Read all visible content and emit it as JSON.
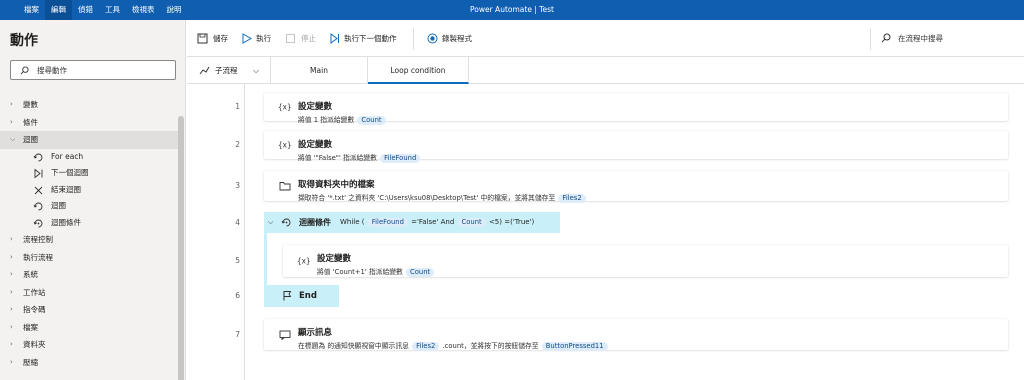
{
  "menu": {
    "items": [
      "檔案",
      "編輯",
      "偵錯",
      "工具",
      "檢視表",
      "說明"
    ],
    "active_index": 1
  },
  "app_title": "Power Automate | Test",
  "actions_pane": {
    "title": "動作",
    "search_placeholder": "搜尋動作",
    "categories_top": [
      {
        "label": "變數",
        "name": "variables"
      },
      {
        "label": "條件",
        "name": "conditions"
      },
      {
        "label": "迴圈",
        "name": "loops"
      }
    ],
    "loop_children": [
      {
        "label": "For each",
        "icon": "loop-icon"
      },
      {
        "label": "下一個迴圈",
        "icon": "next-loop-icon"
      },
      {
        "label": "結束迴圈",
        "icon": "exit-loop-icon"
      },
      {
        "label": "迴圈",
        "icon": "loop-icon"
      },
      {
        "label": "迴圈條件",
        "icon": "loop-condition-icon"
      }
    ],
    "categories_bottom": [
      {
        "label": "流程控制",
        "name": "flow-control"
      },
      {
        "label": "執行流程",
        "name": "run-flow"
      },
      {
        "label": "系統",
        "name": "system"
      },
      {
        "label": "工作站",
        "name": "workstation"
      },
      {
        "label": "指令碼",
        "name": "scripting"
      },
      {
        "label": "檔案",
        "name": "file"
      },
      {
        "label": "資料夾",
        "name": "folder"
      },
      {
        "label": "壓縮",
        "name": "compression"
      }
    ]
  },
  "toolbar": {
    "save": "儲存",
    "run": "執行",
    "stop": "停止",
    "run_next": "執行下一個動作",
    "record": "錄製程式",
    "search_flow": "在流程中搜尋"
  },
  "tabs": {
    "subflow": "子流程",
    "items": [
      "Main",
      "Loop condition"
    ],
    "active_index": 1
  },
  "steps": [
    {
      "no": "1",
      "icon": "{x}",
      "title": "設定變數",
      "desc": [
        {
          "t": "將值 1 指派給變數 "
        },
        {
          "v": "Count"
        }
      ]
    },
    {
      "no": "2",
      "icon": "{x}",
      "title": "設定變數",
      "desc": [
        {
          "t": "將值 '\"False\"' 指派給變數 "
        },
        {
          "v": "FileFound"
        }
      ]
    },
    {
      "no": "3",
      "icon": "folder",
      "title": "取得資料夾中的檔案",
      "desc": [
        {
          "t": "擷取符合 '*.txt' 之資料夾 'C:\\Users\\ksu08\\Desktop\\Test' 中的檔案，並將其儲存至 "
        },
        {
          "v": "Files2"
        }
      ]
    },
    {
      "no": "4",
      "loop": true,
      "title": "迴圈條件",
      "desc": [
        {
          "t": "While ( "
        },
        {
          "v": "FileFound"
        },
        {
          "t": " ='False' And "
        },
        {
          "v": "Count"
        },
        {
          "t": " <5) =('True')"
        }
      ]
    },
    {
      "no": "5",
      "icon": "{x}",
      "title": "設定變數",
      "desc": [
        {
          "t": "將值 'Count+1' 指派給變數 "
        },
        {
          "v": "Count"
        }
      ]
    },
    {
      "no": "6",
      "end": true,
      "title": "End"
    },
    {
      "no": "7",
      "icon": "msg",
      "title": "顯示訊息",
      "desc": [
        {
          "t": "在標題為  的通知快顯視窗中顯示訊息 "
        },
        {
          "v": "Files2"
        },
        {
          "t": " .count，並將按下的按鈕儲存至 "
        },
        {
          "v": "ButtonPressed11"
        }
      ]
    }
  ],
  "colors": {
    "titlebar": "#0f5eb0",
    "loop_highlight": "#c9f0f8",
    "pill_bg": "#deecf9",
    "accent": "#0f6cbd"
  }
}
